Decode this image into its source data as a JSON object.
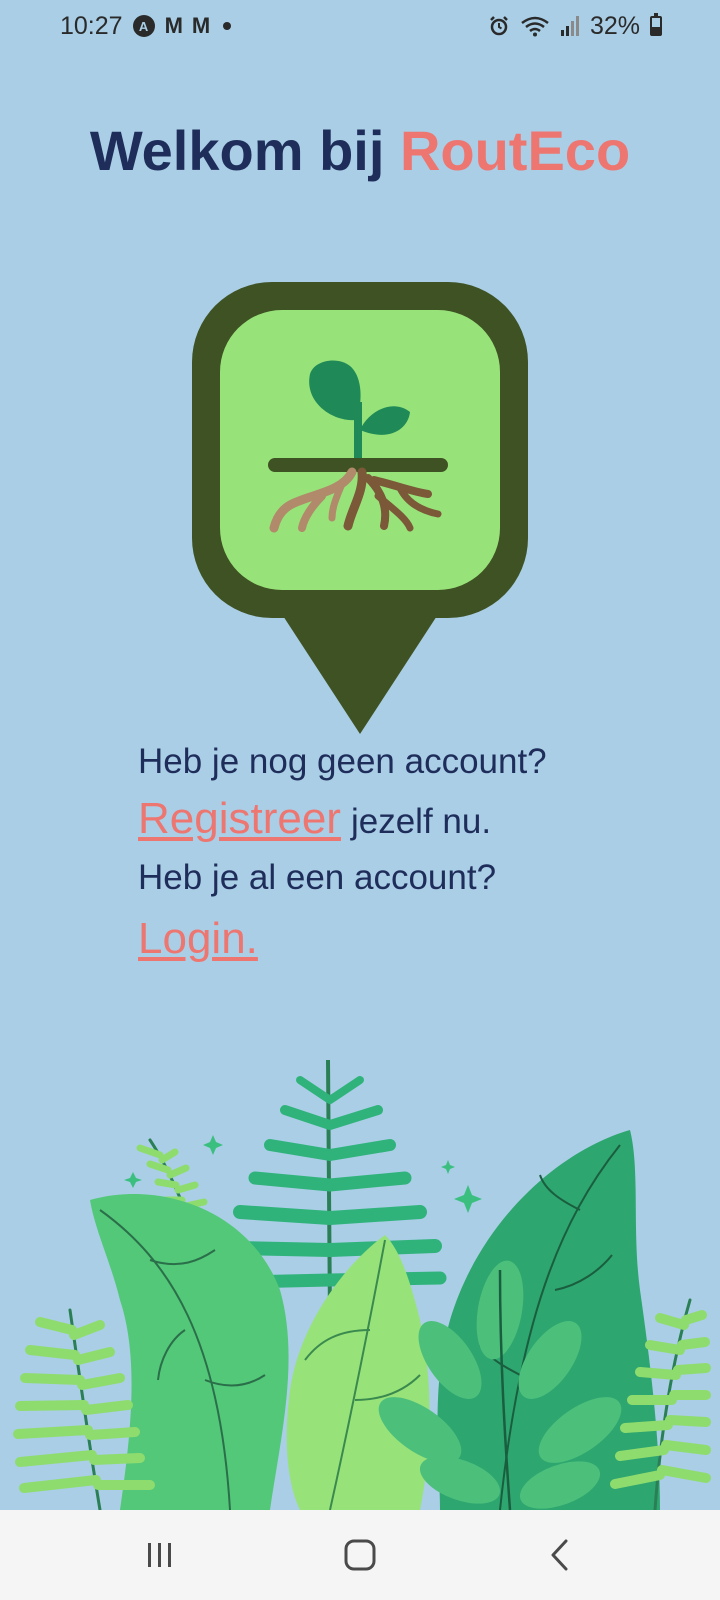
{
  "status_bar": {
    "time": "10:27",
    "notification_icons": [
      "a-circle-icon",
      "gmail-icon",
      "gmail-icon",
      "dot-icon"
    ],
    "system_icons": [
      "alarm-icon",
      "wifi-icon",
      "signal-icon",
      "battery-icon"
    ],
    "battery_percent": "32%"
  },
  "title": {
    "prefix": "Welkom bij ",
    "brand": "RoutEco"
  },
  "logo": {
    "icon": "sprout-map-pin-logo",
    "colors": {
      "pin": "#3f5223",
      "inner": "#98e27a",
      "leaf": "#1f8a57",
      "ground": "#3f5223",
      "root_light": "#b08a6a",
      "root_dark": "#7a5838"
    }
  },
  "main": {
    "no_account_question": "Heb je nog geen account?",
    "register_link": "Registreer",
    "register_suffix": "jezelf nu.",
    "has_account_question": "Heb je al een account?",
    "login_link": "Login."
  },
  "nav_bar": {
    "recents": "recents-icon",
    "home": "home-icon",
    "back": "back-icon"
  },
  "colors": {
    "background": "#a9cee6",
    "text": "#1f2d5a",
    "accent": "#ee7671"
  }
}
